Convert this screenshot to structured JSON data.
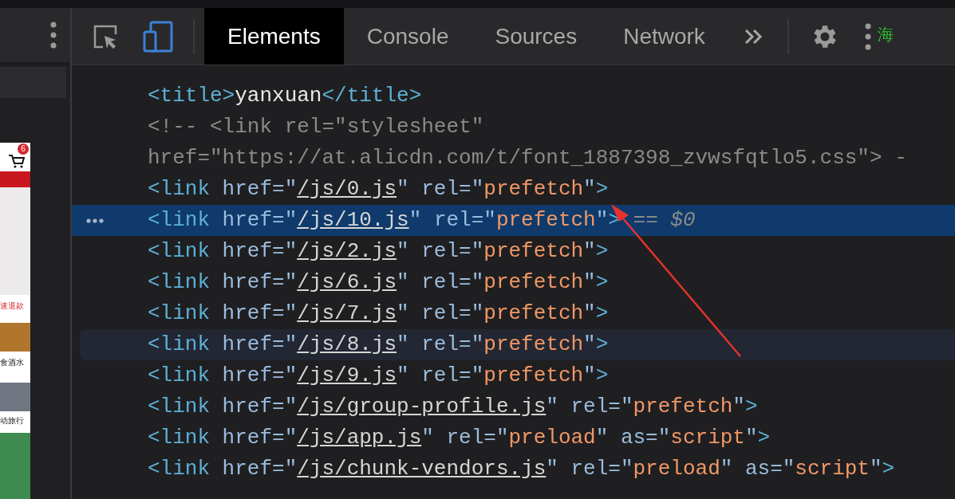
{
  "preview": {
    "cart_badge": "6",
    "labels": [
      "速退款",
      "食酒水",
      "动旅行"
    ]
  },
  "tabs": [
    {
      "label": "Elements",
      "selected": true
    },
    {
      "label": "Console",
      "selected": false
    },
    {
      "label": "Sources",
      "selected": false
    },
    {
      "label": "Network",
      "selected": false
    }
  ],
  "corner_text": "海",
  "code_lines": [
    {
      "selected": false,
      "hovered": false,
      "tokens": [
        {
          "kind": "tag",
          "text": "<title>"
        },
        {
          "kind": "text",
          "text": "yanxuan"
        },
        {
          "kind": "tag",
          "text": "</title>"
        }
      ]
    },
    {
      "selected": false,
      "hovered": false,
      "tokens": [
        {
          "kind": "comment",
          "text": "<!-- <link rel=\"stylesheet\""
        }
      ]
    },
    {
      "selected": false,
      "hovered": false,
      "tokens": [
        {
          "kind": "comment",
          "text": "href=\"https://at.alicdn.com/t/font_1887398_zvwsfqtlo5.css\"> -"
        }
      ]
    },
    {
      "selected": false,
      "hovered": false,
      "tokens": [
        {
          "kind": "tag",
          "text": "<link"
        },
        {
          "kind": "attr",
          "text": " href=\""
        },
        {
          "kind": "link",
          "text": "/js/0.js"
        },
        {
          "kind": "attr",
          "text": "\" rel=\""
        },
        {
          "kind": "value",
          "text": "prefetch"
        },
        {
          "kind": "attr",
          "text": "\""
        },
        {
          "kind": "tag",
          "text": ">"
        }
      ]
    },
    {
      "selected": true,
      "hovered": false,
      "tokens": [
        {
          "kind": "tag",
          "text": "<link"
        },
        {
          "kind": "attr",
          "text": " href=\""
        },
        {
          "kind": "link",
          "text": "/js/10.js"
        },
        {
          "kind": "attr",
          "text": "\" rel=\""
        },
        {
          "kind": "value",
          "text": "prefetch"
        },
        {
          "kind": "attr",
          "text": "\""
        },
        {
          "kind": "tag",
          "text": ">"
        },
        {
          "kind": "ref",
          "text": " == $0"
        }
      ]
    },
    {
      "selected": false,
      "hovered": false,
      "tokens": [
        {
          "kind": "tag",
          "text": "<link"
        },
        {
          "kind": "attr",
          "text": " href=\""
        },
        {
          "kind": "link",
          "text": "/js/2.js"
        },
        {
          "kind": "attr",
          "text": "\" rel=\""
        },
        {
          "kind": "value",
          "text": "prefetch"
        },
        {
          "kind": "attr",
          "text": "\""
        },
        {
          "kind": "tag",
          "text": ">"
        }
      ]
    },
    {
      "selected": false,
      "hovered": false,
      "tokens": [
        {
          "kind": "tag",
          "text": "<link"
        },
        {
          "kind": "attr",
          "text": " href=\""
        },
        {
          "kind": "link",
          "text": "/js/6.js"
        },
        {
          "kind": "attr",
          "text": "\" rel=\""
        },
        {
          "kind": "value",
          "text": "prefetch"
        },
        {
          "kind": "attr",
          "text": "\""
        },
        {
          "kind": "tag",
          "text": ">"
        }
      ]
    },
    {
      "selected": false,
      "hovered": false,
      "tokens": [
        {
          "kind": "tag",
          "text": "<link"
        },
        {
          "kind": "attr",
          "text": " href=\""
        },
        {
          "kind": "link",
          "text": "/js/7.js"
        },
        {
          "kind": "attr",
          "text": "\" rel=\""
        },
        {
          "kind": "value",
          "text": "prefetch"
        },
        {
          "kind": "attr",
          "text": "\""
        },
        {
          "kind": "tag",
          "text": ">"
        }
      ]
    },
    {
      "selected": false,
      "hovered": true,
      "tokens": [
        {
          "kind": "tag",
          "text": "<link"
        },
        {
          "kind": "attr",
          "text": " href=\""
        },
        {
          "kind": "link",
          "text": "/js/8.js"
        },
        {
          "kind": "attr",
          "text": "\" rel=\""
        },
        {
          "kind": "value",
          "text": "prefetch"
        },
        {
          "kind": "attr",
          "text": "\""
        },
        {
          "kind": "tag",
          "text": ">"
        }
      ]
    },
    {
      "selected": false,
      "hovered": false,
      "tokens": [
        {
          "kind": "tag",
          "text": "<link"
        },
        {
          "kind": "attr",
          "text": " href=\""
        },
        {
          "kind": "link",
          "text": "/js/9.js"
        },
        {
          "kind": "attr",
          "text": "\" rel=\""
        },
        {
          "kind": "value",
          "text": "prefetch"
        },
        {
          "kind": "attr",
          "text": "\""
        },
        {
          "kind": "tag",
          "text": ">"
        }
      ]
    },
    {
      "selected": false,
      "hovered": false,
      "tokens": [
        {
          "kind": "tag",
          "text": "<link"
        },
        {
          "kind": "attr",
          "text": " href=\""
        },
        {
          "kind": "link",
          "text": "/js/group-profile.js"
        },
        {
          "kind": "attr",
          "text": "\" rel=\""
        },
        {
          "kind": "value",
          "text": "prefetch"
        },
        {
          "kind": "attr",
          "text": "\""
        },
        {
          "kind": "tag",
          "text": ">"
        }
      ]
    },
    {
      "selected": false,
      "hovered": false,
      "tokens": [
        {
          "kind": "tag",
          "text": "<link"
        },
        {
          "kind": "attr",
          "text": " href=\""
        },
        {
          "kind": "link",
          "text": "/js/app.js"
        },
        {
          "kind": "attr",
          "text": "\" rel=\""
        },
        {
          "kind": "value",
          "text": "preload"
        },
        {
          "kind": "attr",
          "text": "\" as=\""
        },
        {
          "kind": "value",
          "text": "script"
        },
        {
          "kind": "attr",
          "text": "\""
        },
        {
          "kind": "tag",
          "text": ">"
        }
      ]
    },
    {
      "selected": false,
      "hovered": false,
      "tokens": [
        {
          "kind": "tag",
          "text": "<link"
        },
        {
          "kind": "attr",
          "text": " href=\""
        },
        {
          "kind": "link",
          "text": "/js/chunk-vendors.js"
        },
        {
          "kind": "attr",
          "text": "\" rel=\""
        },
        {
          "kind": "value",
          "text": "preload"
        },
        {
          "kind": "attr",
          "text": "\" as=\""
        },
        {
          "kind": "value",
          "text": "script"
        },
        {
          "kind": "attr",
          "text": "\""
        },
        {
          "kind": "tag",
          "text": ">"
        }
      ]
    }
  ]
}
